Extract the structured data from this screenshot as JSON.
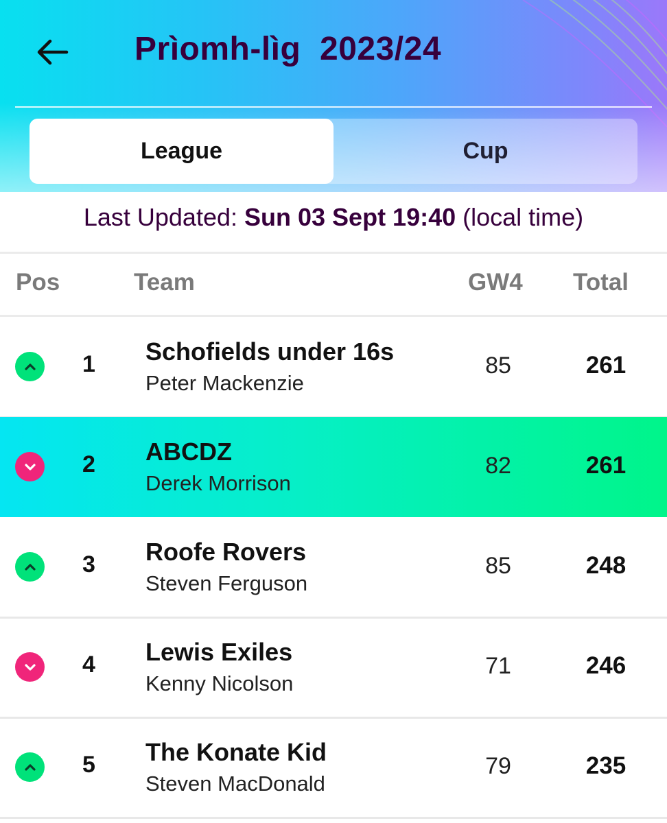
{
  "header": {
    "title": "Prìomh-lìg  2023/24",
    "back_icon": "arrow-left-icon"
  },
  "tabs": [
    {
      "label": "League",
      "active": true
    },
    {
      "label": "Cup",
      "active": false
    }
  ],
  "last_updated": {
    "prefix": "Last Updated: ",
    "date": "Sun 03 Sept 19:40",
    "suffix": " (local time)"
  },
  "table": {
    "columns": {
      "pos": "Pos",
      "team": "Team",
      "gw": "GW4",
      "total": "Total"
    },
    "rows": [
      {
        "movement": "up",
        "pos": "1",
        "team": "Schofields under 16s",
        "manager": "Peter Mackenzie",
        "gw": "85",
        "total": "261",
        "highlight": false
      },
      {
        "movement": "down",
        "pos": "2",
        "team": "ABCDZ",
        "manager": "Derek Morrison",
        "gw": "82",
        "total": "261",
        "highlight": true
      },
      {
        "movement": "up",
        "pos": "3",
        "team": "Roofe Rovers",
        "manager": "Steven Ferguson",
        "gw": "85",
        "total": "248",
        "highlight": false
      },
      {
        "movement": "down",
        "pos": "4",
        "team": "Lewis Exiles",
        "manager": "Kenny Nicolson",
        "gw": "71",
        "total": "246",
        "highlight": false
      },
      {
        "movement": "up",
        "pos": "5",
        "team": "The Konate Kid",
        "manager": "Steven MacDonald",
        "gw": "79",
        "total": "235",
        "highlight": false
      }
    ]
  },
  "colors": {
    "title": "#37003c",
    "up": "#00e27a",
    "down": "#f0257a",
    "highlight_start": "#05e6f2",
    "highlight_end": "#00f58a"
  }
}
